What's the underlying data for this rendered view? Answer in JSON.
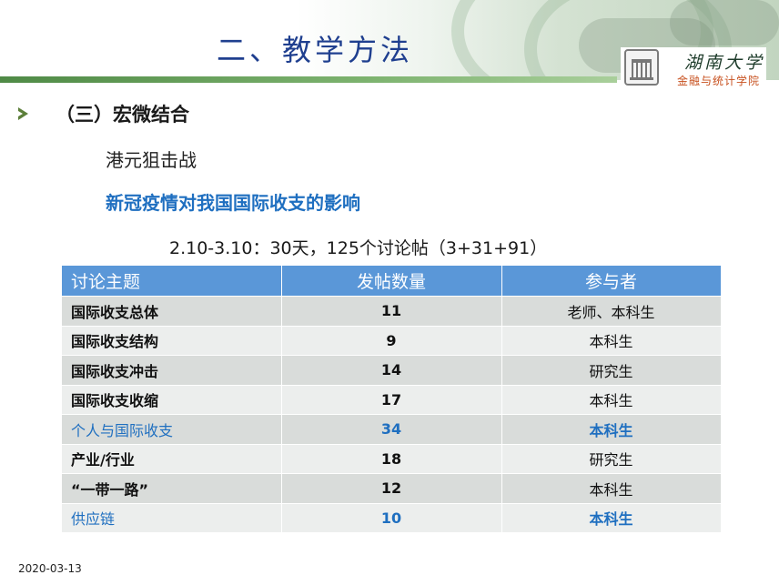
{
  "header": {
    "title": "二、教学方法",
    "university": "湖南大学",
    "school": "金融与统计学院"
  },
  "content": {
    "section_heading": "（三）宏微结合",
    "sub_topic": "港元狙击战",
    "highlight_topic": "新冠疫情对我国国际收支的影响",
    "period_summary": "2.10-3.10：30天，125个讨论帖（3+31+91）"
  },
  "table": {
    "headers": [
      "讨论主题",
      "发帖数量",
      "参与者"
    ],
    "rows": [
      {
        "topic": "国际收支总体",
        "count": "11",
        "participants": "老师、本科生",
        "highlight": false
      },
      {
        "topic": "国际收支结构",
        "count": "9",
        "participants": "本科生",
        "highlight": false
      },
      {
        "topic": "国际收支冲击",
        "count": "14",
        "participants": "研究生",
        "highlight": false
      },
      {
        "topic": "国际收支收缩",
        "count": "17",
        "participants": "本科生",
        "highlight": false
      },
      {
        "topic": "个人与国际收支",
        "count": "34",
        "participants": "本科生",
        "highlight": true
      },
      {
        "topic": "产业/行业",
        "count": "18",
        "participants": "研究生",
        "highlight": false
      },
      {
        "topic": "“一带一路”",
        "count": "12",
        "participants": "本科生",
        "highlight": false
      },
      {
        "topic": "供应链",
        "count": "10",
        "participants": "本科生",
        "highlight": true
      }
    ]
  },
  "footer": {
    "date": "2020-03-13"
  },
  "colors": {
    "title": "#1f3f8f",
    "header_rule": "#4f8a46",
    "table_header": "#5a97d8",
    "highlight_text": "#1f6fc0",
    "row_dark": "#d9dcda",
    "row_light": "#eceeed"
  }
}
